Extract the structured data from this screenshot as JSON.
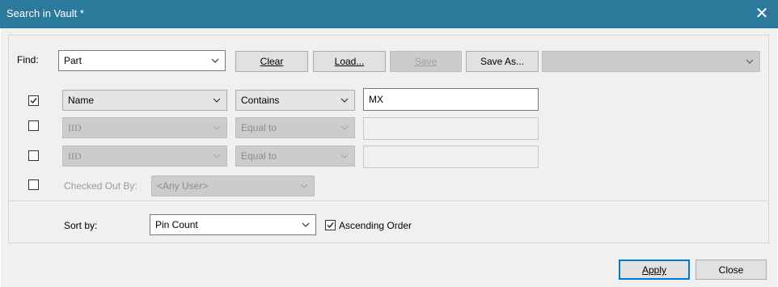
{
  "window": {
    "title": "Search in Vault *",
    "close_glyph": "✕"
  },
  "find": {
    "label": "Find:",
    "value": "Part"
  },
  "buttons": {
    "clear": "Clear",
    "load": "Load...",
    "save": "Save",
    "save_as": "Save As...",
    "apply": "Apply",
    "close": "Close"
  },
  "saved_search": {
    "value": ""
  },
  "criteria": [
    {
      "checked": true,
      "field": "Name",
      "operator": "Contains",
      "value": "MX",
      "enabled": true
    },
    {
      "checked": false,
      "field": "IID",
      "operator": "Equal to",
      "value": "",
      "enabled": false
    },
    {
      "checked": false,
      "field": "IID",
      "operator": "Equal to",
      "value": "",
      "enabled": false
    }
  ],
  "checked_out": {
    "checked": false,
    "label": "Checked Out By:",
    "value": "<Any User>"
  },
  "sort": {
    "label": "Sort by:",
    "value": "Pin Count",
    "ascending_label": "Ascending Order",
    "ascending_checked": true
  },
  "icons": {
    "close": "close-icon",
    "dropdown": "chevron-down-icon",
    "check": "checkmark-icon"
  },
  "colors": {
    "titlebar": "#2b7a9b",
    "dialog_bg": "#f0f0f0",
    "default_button_border": "#0078d7"
  }
}
